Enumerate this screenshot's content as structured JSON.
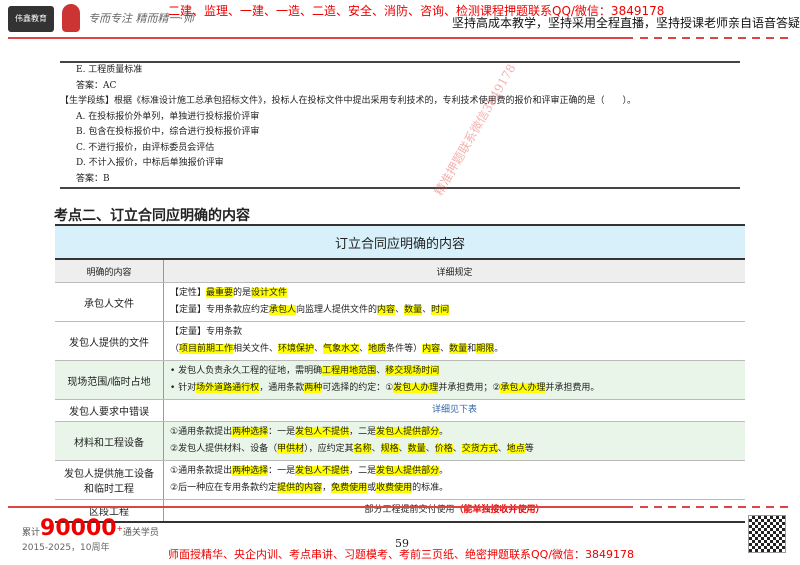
{
  "header": {
    "logo": "伟鑫教育",
    "signature": "专而专注 精而精一·师",
    "red_text": "二建、监理、一建、一造、二造、安全、消防、咨询、检测课程押题联系QQ/微信：3849178",
    "slogan": "坚持高成本教学，坚持采用全程直播，坚持授课老师亲自语音答疑"
  },
  "question": {
    "lines": [
      "E. 工程质量标准",
      "答案：AC",
      "【生学段练】根据《标准设计施工总承包招标文件》，投标人在投标文件中提出采用专利技术的，专利技术使用费的报价和评审正确的是（　　）。",
      "A. 在投标报价外单列，单独进行投标报价评审",
      "B. 包含在投标报价中，综合进行投标报价评审",
      "C. 不进行报价，由评标委员会评估",
      "D. 不计入报价，中标后单独报价评审",
      "答案：B"
    ]
  },
  "watermark": "精准押题联系微信3849178",
  "section_title": "考点二、订立合同应明确的内容",
  "table": {
    "title": "订立合同应明确的内容",
    "col1": "明确的内容",
    "col2": "详细规定",
    "rows": [
      {
        "label": "承包人文件",
        "lines": [
          [
            [
              "【定性】",
              0
            ],
            [
              "最重要",
              1
            ],
            [
              "的是",
              0
            ],
            [
              "设计文件",
              1
            ]
          ],
          [
            [
              "【定量】专用条款应约定",
              0
            ],
            [
              "承包人",
              1
            ],
            [
              "向监理人提供文件的",
              0
            ],
            [
              "内容",
              1
            ],
            [
              "、",
              0
            ],
            [
              "数量",
              1
            ],
            [
              "、",
              0
            ],
            [
              "时间",
              1
            ]
          ]
        ]
      },
      {
        "label": "发包人提供的文件",
        "lines": [
          [
            [
              "【定量】专用条款",
              0
            ]
          ],
          [
            [
              "（",
              0
            ],
            [
              "项目前期工作",
              1
            ],
            [
              "相关文件、",
              0
            ],
            [
              "环境保护",
              1
            ],
            [
              "、",
              0
            ],
            [
              "气象水文",
              1
            ],
            [
              "、",
              0
            ],
            [
              "地质",
              1
            ],
            [
              "条件等）",
              0
            ],
            [
              "内容",
              1
            ],
            [
              "、",
              0
            ],
            [
              "数量",
              1
            ],
            [
              "和",
              0
            ],
            [
              "期限",
              1
            ],
            [
              "。",
              0
            ]
          ]
        ]
      },
      {
        "label": "现场范围/临时占地",
        "green": true,
        "lines": [
          [
            [
              "• 发包人负责永久工程的征地，需明确",
              0
            ],
            [
              "工程用地范围",
              1
            ],
            [
              "、",
              0
            ],
            [
              "移交现场时间",
              1
            ]
          ],
          [
            [
              "• 针对",
              0
            ],
            [
              "场外道路通行权",
              1
            ],
            [
              "，通用条款",
              0
            ],
            [
              "两种",
              1
            ],
            [
              "可选择的约定：①",
              0
            ],
            [
              "发包人办理",
              1
            ],
            [
              "并承担费用；②",
              0
            ],
            [
              "承包人办理",
              1
            ],
            [
              "并承担费用。",
              0
            ]
          ]
        ]
      },
      {
        "label": "发包人要求中错误",
        "center": true,
        "lines": [
          [
            [
              "详细见下表",
              2
            ]
          ]
        ]
      },
      {
        "label": "材料和工程设备",
        "green": true,
        "lines": [
          [
            [
              "①通用条款提出",
              0
            ],
            [
              "两种选择",
              1
            ],
            [
              "：一是",
              0
            ],
            [
              "发包人不提供",
              1
            ],
            [
              "，二是",
              0
            ],
            [
              "发包人提供部分",
              1
            ],
            [
              "。",
              0
            ]
          ],
          [
            [
              "②发包人提供材料、设备（",
              0
            ],
            [
              "甲供材",
              1
            ],
            [
              "），应约定其",
              0
            ],
            [
              "名称",
              1
            ],
            [
              "、",
              0
            ],
            [
              "规格",
              1
            ],
            [
              "、",
              0
            ],
            [
              "数量",
              1
            ],
            [
              "、",
              0
            ],
            [
              "价格",
              1
            ],
            [
              "、",
              0
            ],
            [
              "交货方式",
              1
            ],
            [
              "、",
              0
            ],
            [
              "地点",
              1
            ],
            [
              "等",
              0
            ]
          ]
        ]
      },
      {
        "label": "发包人提供施工设备和临时工程",
        "lines": [
          [
            [
              "①通用条款提出",
              0
            ],
            [
              "两种选择",
              1
            ],
            [
              "：一是",
              0
            ],
            [
              "发包人不提供",
              1
            ],
            [
              "，二是",
              0
            ],
            [
              "发包人提供部分",
              1
            ],
            [
              "。",
              0
            ]
          ],
          [
            [
              "②后一种应在专用条款约定",
              0
            ],
            [
              "提供的内容",
              1
            ],
            [
              "，",
              0
            ],
            [
              "免费使用",
              1
            ],
            [
              "或",
              0
            ],
            [
              "收费使用",
              1
            ],
            [
              "的标准。",
              0
            ]
          ]
        ]
      },
      {
        "label": "区段工程",
        "center": true,
        "last": true,
        "lines": [
          [
            [
              "部分工程提前交付使用",
              0
            ],
            [
              "（能单独接收并使用）",
              3
            ]
          ]
        ]
      }
    ]
  },
  "footer": {
    "prefix": "累计",
    "count": "90000",
    "plus": "+",
    "suffix": "通关学员",
    "years": "2015-2025，10周年",
    "page": "59",
    "red_text": "师面授精华、央企内训、考点串讲、习题模考、考前三页纸、绝密押题联系QQ/微信：3849178"
  }
}
